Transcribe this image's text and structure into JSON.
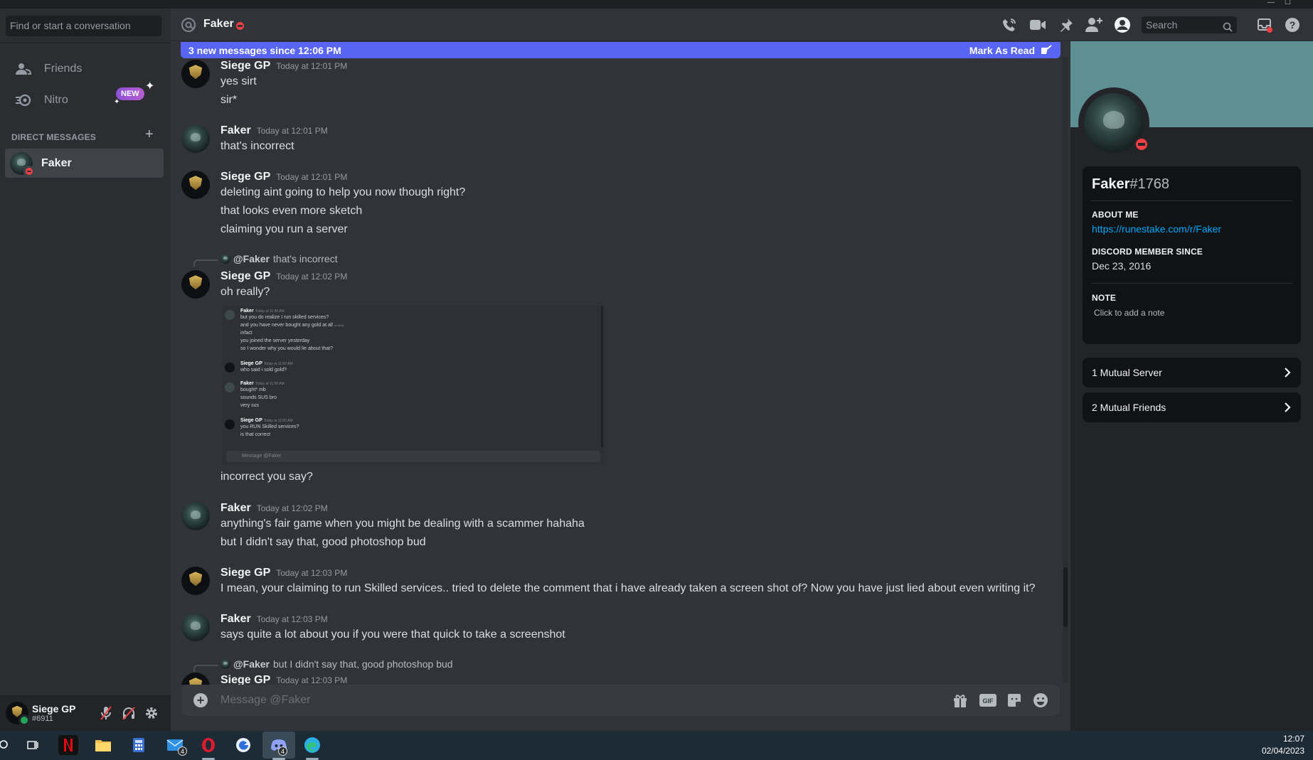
{
  "window": {
    "controls": [
      "—",
      "☐"
    ]
  },
  "sidebar": {
    "search_placeholder": "Find or start a conversation",
    "nav": [
      {
        "label": "Friends",
        "icon": "friends-icon"
      },
      {
        "label": "Nitro",
        "icon": "nitro-icon",
        "badge": "NEW"
      }
    ],
    "dm_header": "DIRECT MESSAGES",
    "dms": [
      {
        "name": "Faker",
        "status": "dnd"
      }
    ]
  },
  "user_panel": {
    "name": "Siege GP",
    "tag": "#6911",
    "status": "online"
  },
  "header": {
    "channel_name": "Faker",
    "status": "dnd",
    "search_placeholder": "Search",
    "icons": [
      "call-icon",
      "video-icon",
      "pin-icon",
      "add-friend-icon",
      "profile-icon",
      "inbox-icon",
      "help-icon"
    ]
  },
  "new_messages_bar": {
    "text": "3 new messages since 12:06 PM",
    "action": "Mark As Read"
  },
  "messages": [
    {
      "author": "Siege GP",
      "time": "Today at 12:01 PM",
      "lines": [
        "yes sirt",
        "sir*"
      ]
    },
    {
      "author": "Faker",
      "time": "Today at 12:01 PM",
      "lines": [
        "that's incorrect"
      ]
    },
    {
      "author": "Siege GP",
      "time": "Today at 12:01 PM",
      "lines": [
        "deleting aint going to help you now though right?",
        "that looks even more sketch",
        "claiming you run a server"
      ]
    },
    {
      "reply": {
        "mention": "@Faker",
        "text": "that's incorrect"
      },
      "author": "Siege GP",
      "time": "Today at 12:02 PM",
      "lines": [
        "oh really?",
        "incorrect you say?"
      ]
    },
    {
      "author": "Faker",
      "time": "Today at 12:02 PM",
      "lines": [
        "anything's fair game when you might be dealing with a scammer hahaha",
        "but I didn't say that, good photoshop bud"
      ]
    },
    {
      "author": "Siege GP",
      "time": "Today at 12:03 PM",
      "lines": [
        "I mean, your claiming to run Skilled services.. tried to delete the comment that i have already taken a screen shot of? Now you have just lied about even writing it?"
      ]
    },
    {
      "author": "Faker",
      "time": "Today at 12:03 PM",
      "lines": [
        "says quite a lot about you if you were that quick to take a screenshot"
      ]
    },
    {
      "reply": {
        "mention": "@Faker",
        "text": "but I didn't say that, good photoshop bud"
      },
      "author": "Siege GP",
      "time": "Today at 12:03 PM",
      "lines": []
    }
  ],
  "screenshot_attachment": {
    "items": [
      {
        "author": "Faker",
        "time": "Today at 11:49 AM",
        "lines": [
          "but you do realize I run skilled services?",
          "and you have never bought any gold at all",
          "infact",
          "you joined the server yesterday",
          "so I wonder why you would lie about that?"
        ],
        "edited": "(edited)"
      },
      {
        "author": "Siege GP",
        "time": "Today at 11:50 AM",
        "lines": [
          "who said i sold gold?"
        ]
      },
      {
        "author": "Faker",
        "time": "Today at 11:50 AM",
        "lines": [
          "bought* mb",
          "sounds SUS bro",
          "very sus"
        ]
      },
      {
        "author": "Siege GP",
        "time": "Today at 11:50 AM",
        "lines": [
          "you RUN Skilled services?",
          "is that correct"
        ]
      }
    ],
    "placeholder": "Message @Faker"
  },
  "composer": {
    "placeholder": "Message @Faker",
    "icons": [
      "gift-icon",
      "gif-icon",
      "sticker-icon",
      "emoji-icon"
    ]
  },
  "profile": {
    "name": "Faker",
    "discriminator": "#1768",
    "about_label": "ABOUT ME",
    "about_link": "https://runestake.com/r/Faker",
    "member_since_label": "DISCORD MEMBER SINCE",
    "member_since": "Dec 23, 2016",
    "note_label": "NOTE",
    "note_placeholder": "Click to add a note",
    "mutual_servers": "1 Mutual Server",
    "mutual_friends": "2 Mutual Friends",
    "banner_color": "#5e8f92"
  },
  "taskbar": {
    "apps": [
      "search-icon",
      "task-view-icon",
      "netflix-icon",
      "file-explorer-icon",
      "calculator-icon",
      "mail-icon",
      "opera-icon",
      "app-icon",
      "discord-icon",
      "edge-icon"
    ],
    "mail_badge": "4",
    "discord_badge": "4",
    "time": "12:07",
    "date": "02/04/2023"
  },
  "colors": {
    "accent": "#5865f2",
    "dnd": "#f23f43",
    "online": "#23a55a",
    "link": "#00a8fc"
  }
}
